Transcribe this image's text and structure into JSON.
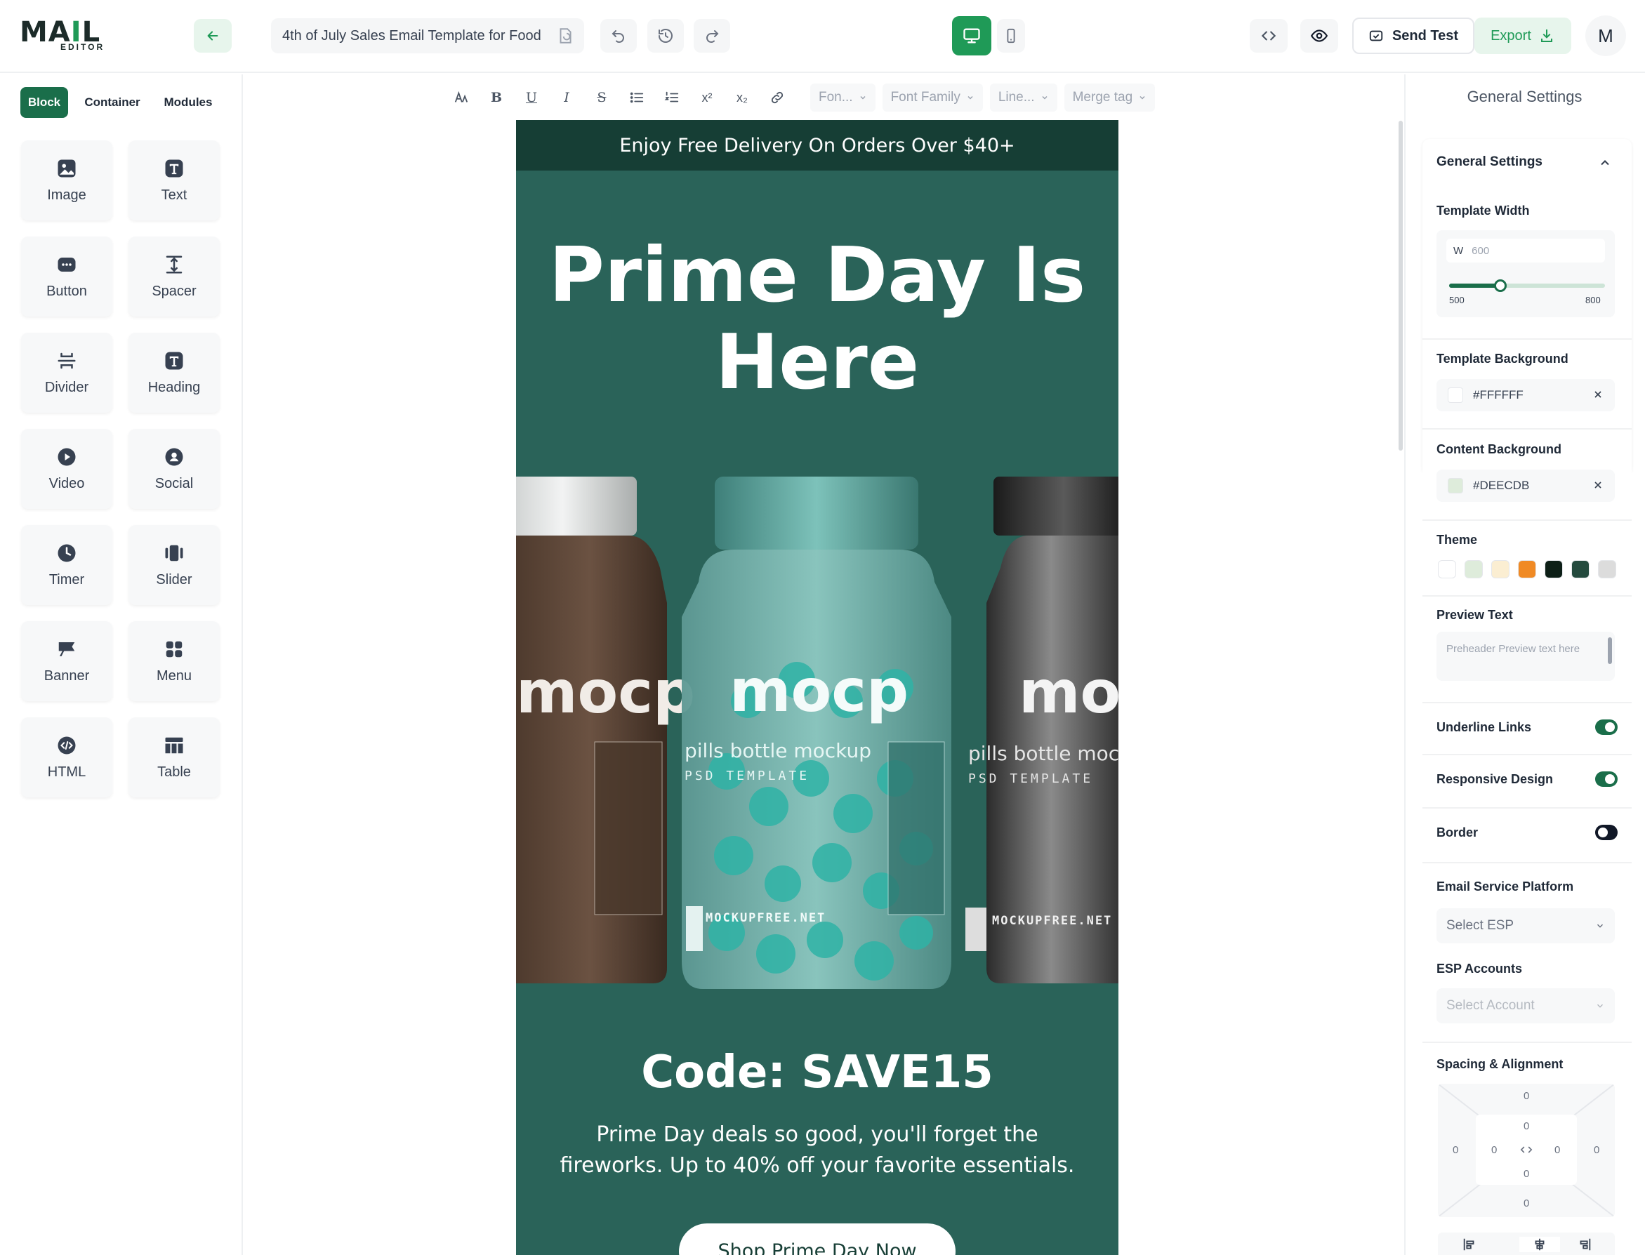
{
  "app": {
    "logo": {
      "word_left": "MA",
      "word_i": "I",
      "word_right": "L",
      "sub": "EDITOR"
    },
    "template_title": "4th of July Sales Email Template for Food",
    "send_test_label": "Send Test",
    "export_label": "Export",
    "avatar_initial": "M",
    "colors": {
      "brand_green": "#1f9a57",
      "dark_green": "#1a6e4a"
    }
  },
  "left_panel": {
    "tabs": [
      {
        "label": "Block",
        "active": true
      },
      {
        "label": "Container",
        "active": false
      },
      {
        "label": "Modules",
        "active": false
      }
    ],
    "blocks": [
      {
        "label": "Image",
        "icon": "image-icon"
      },
      {
        "label": "Text",
        "icon": "text-icon"
      },
      {
        "label": "Button",
        "icon": "button-icon"
      },
      {
        "label": "Spacer",
        "icon": "spacer-icon"
      },
      {
        "label": "Divider",
        "icon": "divider-icon"
      },
      {
        "label": "Heading",
        "icon": "heading-icon"
      },
      {
        "label": "Video",
        "icon": "video-icon"
      },
      {
        "label": "Social",
        "icon": "social-icon"
      },
      {
        "label": "Timer",
        "icon": "timer-icon"
      },
      {
        "label": "Slider",
        "icon": "slider-icon"
      },
      {
        "label": "Banner",
        "icon": "banner-icon"
      },
      {
        "label": "Menu",
        "icon": "menu-icon"
      },
      {
        "label": "HTML",
        "icon": "html-icon"
      },
      {
        "label": "Table",
        "icon": "table-icon"
      }
    ]
  },
  "format_toolbar": {
    "font_size_placeholder": "Fon...",
    "font_family_placeholder": "Font Family",
    "line_height_placeholder": "Line...",
    "merge_tag_placeholder": "Merge tag"
  },
  "email": {
    "top_banner": "Enjoy Free Delivery On Orders Over $40+",
    "headline": "Prime Day Is Here",
    "bottle_brand": "mocp",
    "bottle_caption": "pills bottle mockup",
    "bottle_subcaption": "PSD TEMPLATE",
    "bottle_site": "MOCKUPFREE.NET",
    "code_line": "Code: SAVE15",
    "body_copy": "Prime Day deals so good, you'll forget the fireworks. Up to 40% off your favorite essentials.",
    "cta_label": "Shop Prime Day Now",
    "colors": {
      "band": "#163e35",
      "background": "#2a6359"
    }
  },
  "right_panel": {
    "title": "General Settings",
    "section_title": "General Settings",
    "template_width_label": "Template Width",
    "width_prefix": "W",
    "width_value": "600",
    "width_min": "500",
    "width_max": "800",
    "width_slider_fraction": 0.33,
    "template_background_label": "Template Background",
    "template_background_value": "#FFFFFF",
    "content_background_label": "Content Background",
    "content_background_value": "#DEECDB",
    "theme_label": "Theme",
    "theme_colors": [
      "#ffffff",
      "#deecdb",
      "#fbeed2",
      "#f08a24",
      "#0d1f17",
      "#244a3e",
      "#dcdcdc"
    ],
    "preview_text_label": "Preview Text",
    "preview_text_placeholder": "Preheader Preview text here",
    "underline_links_label": "Underline Links",
    "underline_links_on": true,
    "responsive_design_label": "Responsive Design",
    "responsive_design_on": true,
    "border_label": "Border",
    "border_on": false,
    "esp_label": "Email Service Platform",
    "esp_placeholder": "Select ESP",
    "esp_accounts_label": "ESP Accounts",
    "esp_accounts_placeholder": "Select Account",
    "spacing_label": "Spacing & Alignment",
    "spacing_values": {
      "outer_top": "0",
      "inner_top": "0",
      "outer_left": "0",
      "inner_left": "0",
      "inner_right": "0",
      "outer_right": "0",
      "inner_bottom": "0",
      "outer_bottom": "0"
    }
  }
}
